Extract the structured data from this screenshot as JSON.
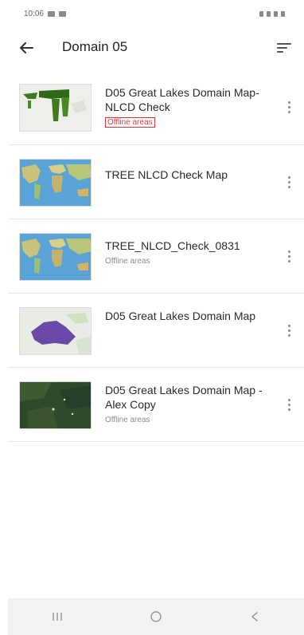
{
  "status_bar": {
    "time": "10:06",
    "left_icons": [
      "notification-icon",
      "gallery-icon"
    ],
    "right_icons": [
      "mute-icon",
      "wifi-icon",
      "signal-icon",
      "battery-icon"
    ]
  },
  "header": {
    "title": "Domain 05",
    "back_icon": "arrow-left-icon",
    "sort_icon": "sort-icon"
  },
  "maps": [
    {
      "title": "D05 Great Lakes Domain Map-NLCD Check",
      "subtitle": "Offline areas",
      "thumbnail": "green-patches-map",
      "highlighted": true
    },
    {
      "title": "TREE NLCD Check Map",
      "subtitle": "",
      "thumbnail": "world-map",
      "highlighted": false
    },
    {
      "title": "TREE_NLCD_Check_0831",
      "subtitle": "Offline areas",
      "thumbnail": "world-map",
      "highlighted": false
    },
    {
      "title": "D05 Great Lakes Domain Map",
      "subtitle": "",
      "thumbnail": "purple-region-map",
      "highlighted": false
    },
    {
      "title": "D05 Great Lakes Domain Map - Alex Copy",
      "subtitle": "Offline areas",
      "thumbnail": "satellite-map",
      "highlighted": false
    }
  ],
  "nav_bar": {
    "buttons": [
      "recent-apps-icon",
      "home-icon",
      "back-icon"
    ]
  },
  "colors": {
    "highlight_border": "#d9363e",
    "nav_background": "#f2f2f2",
    "divider": "#e6e6e6"
  }
}
